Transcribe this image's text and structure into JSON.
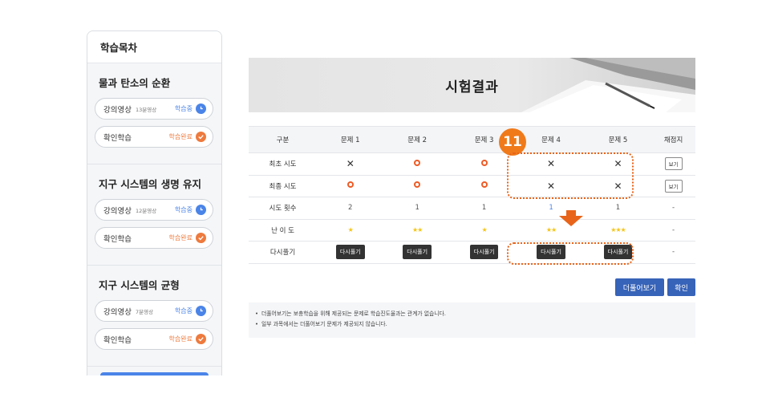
{
  "sidebar": {
    "title": "학습목차",
    "sections": [
      {
        "title": "물과 탄소의 순환",
        "items": [
          {
            "label": "강의영상",
            "duration": "13분영상",
            "status": "학습중",
            "state": "in-progress"
          },
          {
            "label": "확인학습",
            "duration": "",
            "status": "학습완료",
            "state": "done"
          }
        ]
      },
      {
        "title": "지구 시스템의 생명 유지",
        "items": [
          {
            "label": "강의영상",
            "duration": "12분영상",
            "status": "학습중",
            "state": "in-progress"
          },
          {
            "label": "확인학습",
            "duration": "",
            "status": "학습완료",
            "state": "done"
          }
        ]
      },
      {
        "title": "지구 시스템의 균형",
        "items": [
          {
            "label": "강의영상",
            "duration": "7분영상",
            "status": "학습중",
            "state": "in-progress"
          },
          {
            "label": "확인학습",
            "duration": "",
            "status": "학습완료",
            "state": "done"
          }
        ]
      }
    ]
  },
  "main": {
    "title": "시험결과",
    "columns": [
      "구분",
      "문제 1",
      "문제 2",
      "문제 3",
      "문제 4",
      "문제 5",
      "채점지"
    ],
    "rows": {
      "first": {
        "label": "최초 시도",
        "marks": [
          "x",
          "o",
          "o",
          "x",
          "x"
        ],
        "view": "보기"
      },
      "final": {
        "label": "최종 시도",
        "marks": [
          "o",
          "o",
          "o",
          "x",
          "x"
        ],
        "view": "보기"
      },
      "attempts": {
        "label": "시도 횟수",
        "values": [
          "2",
          "1",
          "1",
          "1",
          "1"
        ],
        "extra": "-"
      },
      "difficulty": {
        "label": "난 이 도",
        "stars": [
          1,
          2,
          1,
          2,
          3
        ],
        "extra": "-"
      },
      "retry": {
        "label": "다시풀기",
        "button": "다시풀기",
        "extra": "-"
      }
    },
    "badge": "11",
    "buttons": {
      "more": "더풀어보기",
      "ok": "확인"
    },
    "notes": [
      "더풀어보기는 보충학습을 위해 제공되는 문제로 학습진도율과는 관계가 없습니다.",
      "일부 과목에서는 더풀어보기 문제가 제공되지 않습니다."
    ]
  },
  "colors": {
    "accent": "#4a84e8",
    "done": "#ee7a3d",
    "annotation": "#f07a1a",
    "button": "#3763b8"
  }
}
